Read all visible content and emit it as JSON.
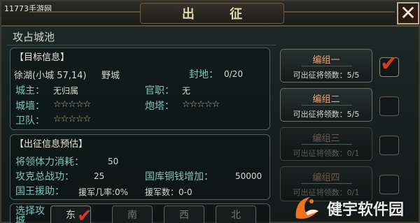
{
  "watermark_top": "11773手游网",
  "title": "出 征",
  "close_label": "✕",
  "section_title": "攻占城池",
  "target": {
    "header": "【目标信息】",
    "location": "徐湖(小城 57,14)",
    "location_type": "野城",
    "fief_label": "封地：",
    "fief_value": "0/20",
    "lord_label": "城主：",
    "lord_value": "无归属",
    "rank_label": "官职：",
    "rank_value": "无",
    "wall_label": "城墙：",
    "wall_stars": "☆☆☆☆☆",
    "tower_label": "炮塔：",
    "tower_stars": "☆☆☆☆☆",
    "guard_label": "卫队：",
    "guard_stars": "☆☆☆☆☆"
  },
  "estimate": {
    "header": "【出征信息预估】",
    "stamina_label": "将领体力消耗：",
    "stamina_value": "50",
    "merit_label": "攻克总战功：",
    "merit_value": "25",
    "copper_label": "国库铜钱增加：",
    "copper_value": "50000",
    "aid_label": "国王援助：",
    "aid_rate": "援军几率:0%",
    "aid_count": "援军数：0-0"
  },
  "groups": [
    {
      "name": "编组一",
      "count": "可出征将领数：5/5",
      "enabled": true,
      "checked": true
    },
    {
      "name": "编组二",
      "count": "可出征将领数：5/5",
      "enabled": true,
      "checked": false
    },
    {
      "name": "编组三",
      "count": "可出征将领数：0/1",
      "enabled": false,
      "checked": false
    },
    {
      "name": "编组四",
      "count": "可出征将领数：0/1",
      "enabled": false,
      "checked": false
    }
  ],
  "direction": {
    "label": "选择攻城",
    "options": [
      "东",
      "南",
      "西",
      "北"
    ]
  },
  "logo_text": "健宇软件园",
  "colors": {
    "accent_label": "#7ec4b9",
    "group_name": "#e9a27c",
    "check": "#d63a22"
  }
}
